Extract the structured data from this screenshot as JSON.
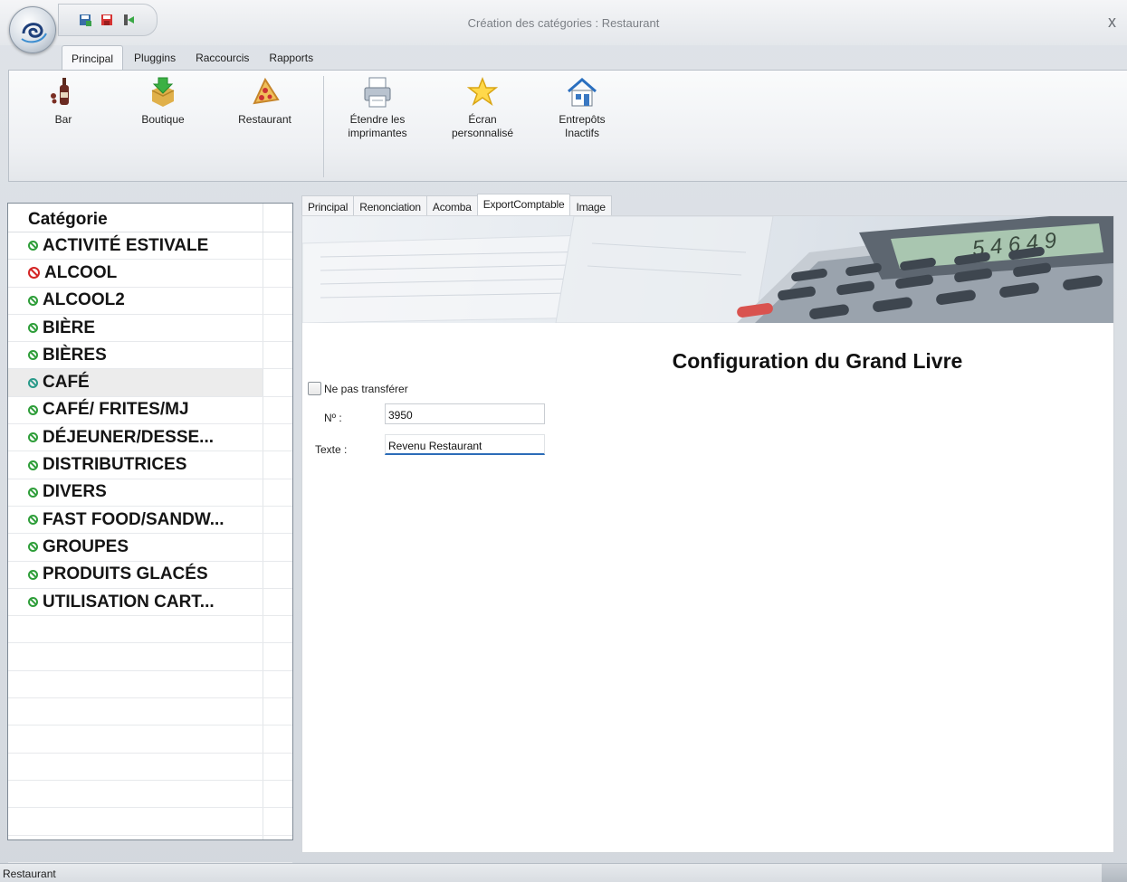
{
  "window": {
    "title": "Création des catégories : Restaurant",
    "close_label": "x"
  },
  "ribbon": {
    "tabs": [
      "Principal",
      "Pluggins",
      "Raccourcis",
      "Rapports"
    ],
    "buttons": [
      {
        "label": "Bar",
        "icon": "wine-bottle-icon"
      },
      {
        "label": "Boutique",
        "icon": "boutique-box-icon"
      },
      {
        "label": "Restaurant",
        "icon": "pizza-icon"
      },
      {
        "label": "Étendre les\nimprimantes",
        "icon": "printer-icon"
      },
      {
        "label": "Écran\npersonnalisé",
        "icon": "star-icon"
      },
      {
        "label": "Entrepôts\nInactifs",
        "icon": "warehouse-icon"
      }
    ]
  },
  "categories": {
    "header": "Catégorie",
    "items": [
      {
        "label": "ACTIVITÉ ESTIVALE",
        "status": "green"
      },
      {
        "label": "ALCOOL",
        "status": "red"
      },
      {
        "label": "ALCOOL2",
        "status": "green"
      },
      {
        "label": "BIÈRE",
        "status": "green"
      },
      {
        "label": "BIÈRES",
        "status": "green"
      },
      {
        "label": "CAFÉ",
        "status": "teal",
        "selected": true
      },
      {
        "label": "CAFÉ/ FRITES/MJ",
        "status": "green"
      },
      {
        "label": "DÉJEUNER/DESSE...",
        "status": "green"
      },
      {
        "label": "DISTRIBUTRICES",
        "status": "green"
      },
      {
        "label": "DIVERS",
        "status": "green"
      },
      {
        "label": "FAST FOOD/SANDW...",
        "status": "green"
      },
      {
        "label": "GROUPES",
        "status": "green"
      },
      {
        "label": "PRODUITS GLACÉS",
        "status": "green"
      },
      {
        "label": "UTILISATION CART...",
        "status": "green"
      }
    ]
  },
  "detail_tabs": [
    "Principal",
    "Renonciation",
    "Acomba",
    "ExportComptable",
    "Image"
  ],
  "active_detail_tab": "ExportComptable",
  "form": {
    "title": "Configuration du Grand Livre",
    "no_transfer_label": "Ne pas transférer",
    "no_transfer_checked": false,
    "number_label": "Nº :",
    "number_value": "3950",
    "text_label": "Texte :",
    "text_value": "Revenu Restaurant"
  },
  "banner": {
    "calculator_display": "5 4 6 4 9"
  },
  "statusbar": {
    "text": "Restaurant"
  },
  "colors": {
    "green": "#2f9e3a",
    "red": "#d42525",
    "teal": "#2a9a8a",
    "focus": "#2b6cb8"
  }
}
